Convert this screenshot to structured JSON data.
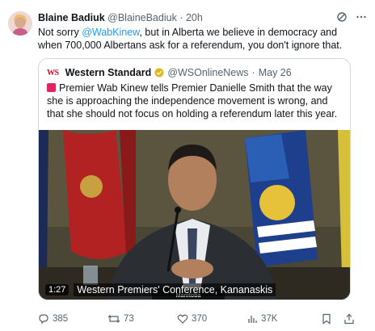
{
  "tweet": {
    "author_name": "Blaine Badiuk",
    "handle": "@BlaineBadiuk",
    "separator": "·",
    "time": "20h",
    "text_before": "Not sorry ",
    "mention": "@WabKinew",
    "text_after": ", but in Alberta we believe in democracy and when 700,000 Albertans ask for a referendum, you don't ignore that."
  },
  "quote": {
    "logo": "WS",
    "author_name": "Western Standard",
    "handle": "@WSOnlineNews",
    "separator": "·",
    "date": "May 26",
    "text": "Premier Wab Kinew tells Premier Danielle Smith that the way she is approaching the independence movement is wrong, and that she should not focus on holding a referendum later this year.",
    "video": {
      "duration": "1:27",
      "caption": "Western Premiers' Conference, Kananaskis",
      "nameplate": "Manitoba"
    }
  },
  "actions": {
    "replies": "385",
    "reposts": "73",
    "likes": "370",
    "views": "37K"
  },
  "colors": {
    "accent": "#1d9bf0",
    "muted": "#536471",
    "verified_badge": "#e2b719"
  }
}
